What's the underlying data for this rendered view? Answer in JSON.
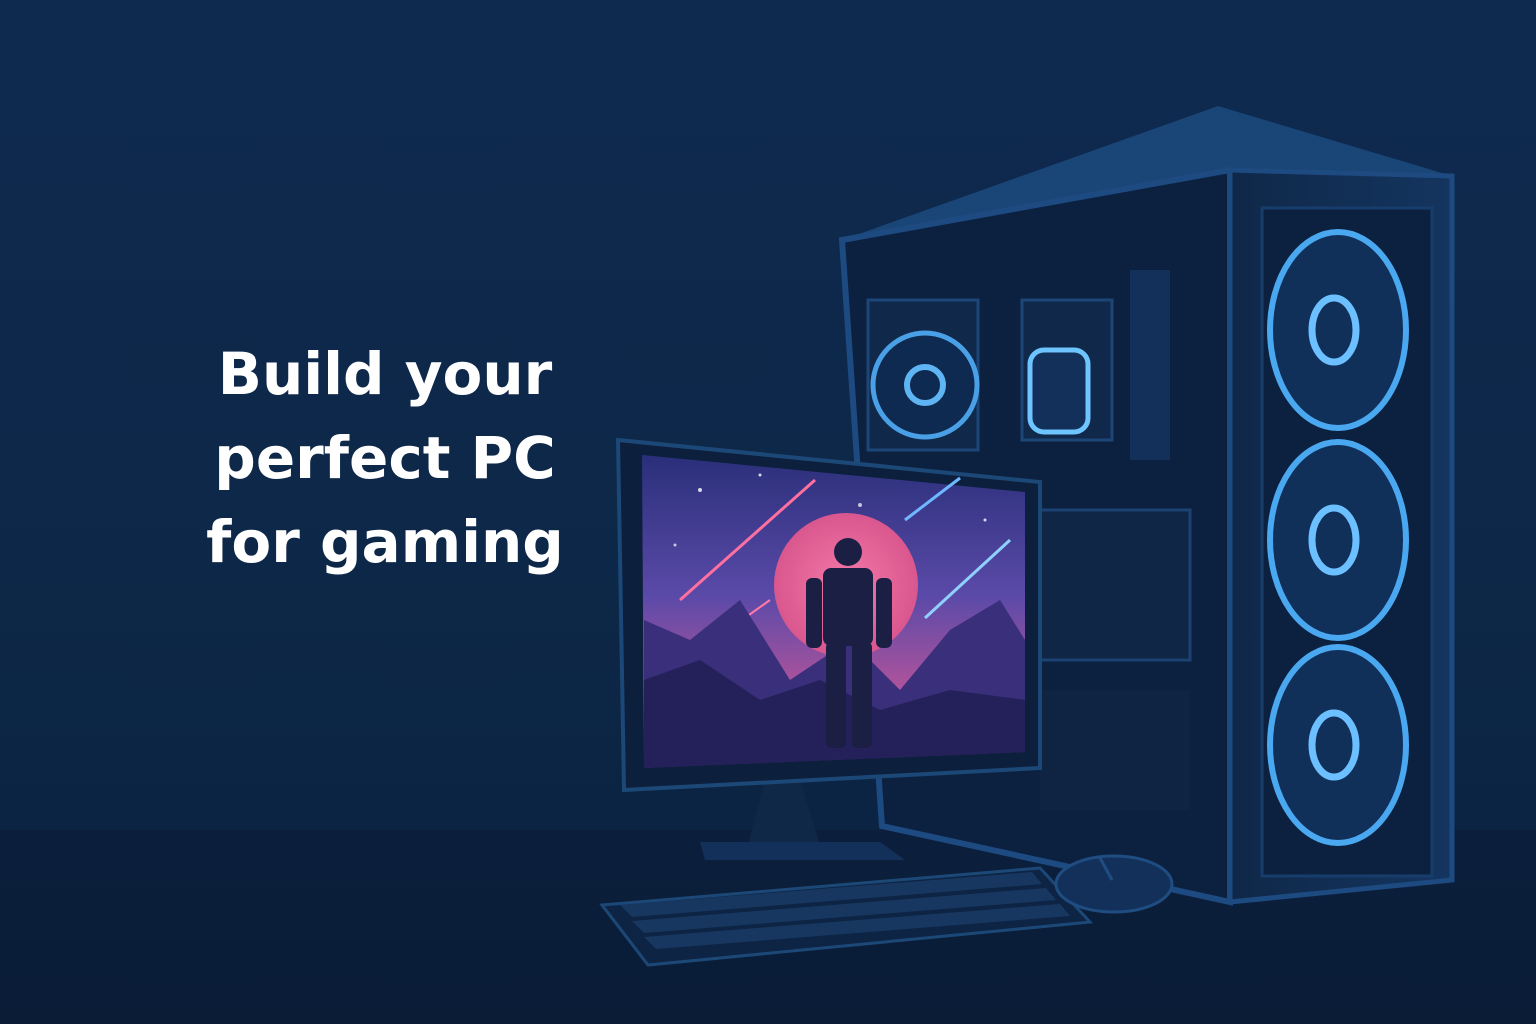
{
  "hero": {
    "headline_lines": [
      "Build your",
      "perfect PC",
      "for gaming"
    ]
  },
  "colors": {
    "background": "#0d2648",
    "headline": "#ffffff",
    "fan_glow": "#4aa8f0",
    "screen_sunset": "#e86a9a",
    "screen_sky": "#3a3f9a"
  },
  "illustration": {
    "icons": [
      "pc-tower-icon",
      "monitor-icon",
      "keyboard-icon",
      "mouse-icon",
      "fan-icon"
    ]
  }
}
